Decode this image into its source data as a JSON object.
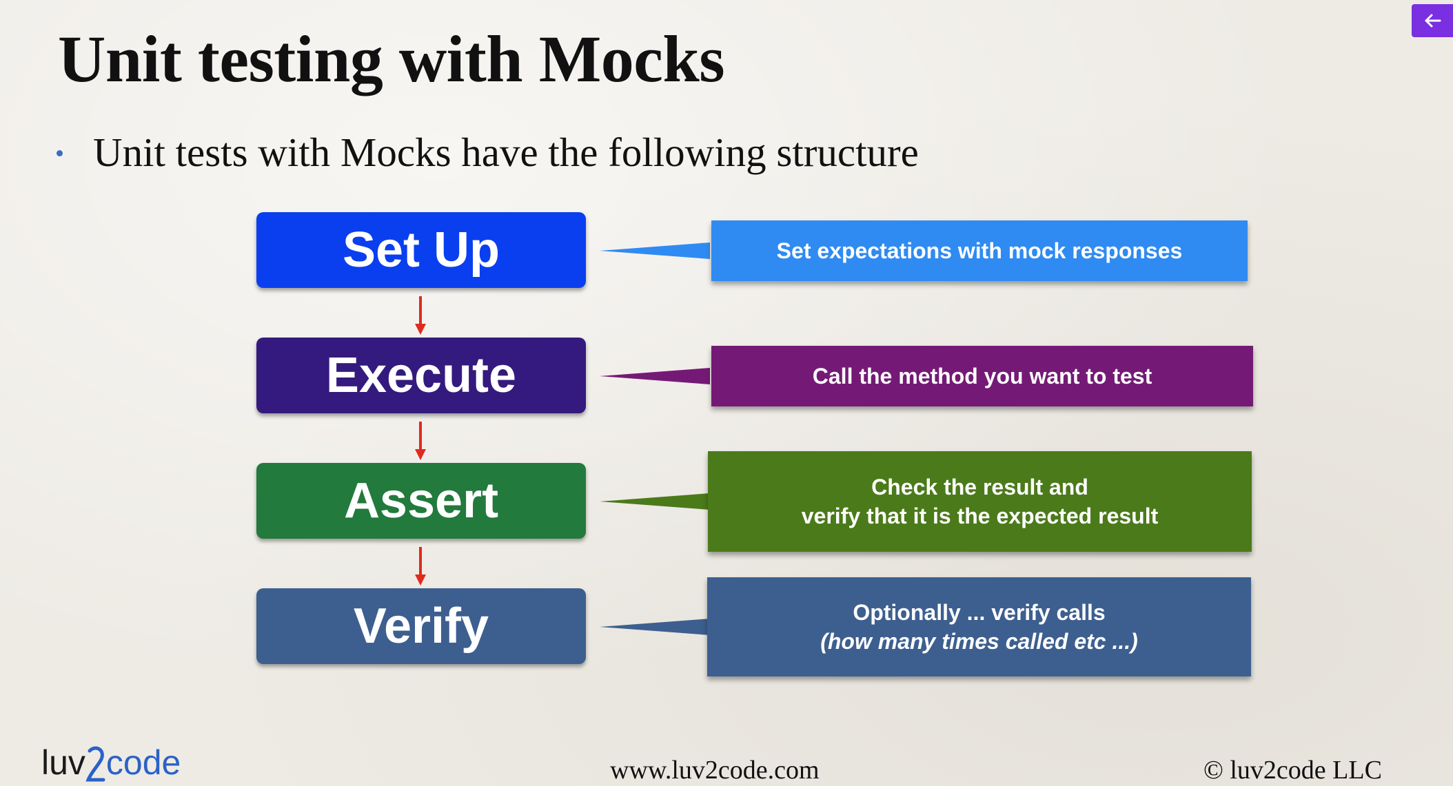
{
  "slide": {
    "title": "Unit testing with Mocks",
    "bullet": "Unit tests with Mocks have the following structure"
  },
  "steps": [
    {
      "label": "Set Up",
      "color": "#0a3ff0",
      "callout_color": "#2f8bf2",
      "callout_lines": [
        "Set expectations with mock responses"
      ]
    },
    {
      "label": "Execute",
      "color": "#341a7e",
      "callout_color": "#741a76",
      "callout_lines": [
        "Call the method you want to test"
      ]
    },
    {
      "label": "Assert",
      "color": "#227a3c",
      "callout_color": "#4b7a1a",
      "callout_lines": [
        "Check the result and",
        "verify that it is the expected result"
      ]
    },
    {
      "label": "Verify",
      "color": "#3d5f8f",
      "callout_color": "#3d5f8f",
      "callout_lines": [
        "Optionally ... verify calls",
        "(how many times called etc ...)"
      ]
    }
  ],
  "arrow_color": "#e02a1e",
  "footer": {
    "logo_left": "luv",
    "logo_right": "code",
    "url": "www.luv2code.com",
    "copyright": "© luv2code LLC"
  },
  "controls": {
    "back_icon": "arrow-left-icon",
    "back_color": "#7a2fe0"
  }
}
